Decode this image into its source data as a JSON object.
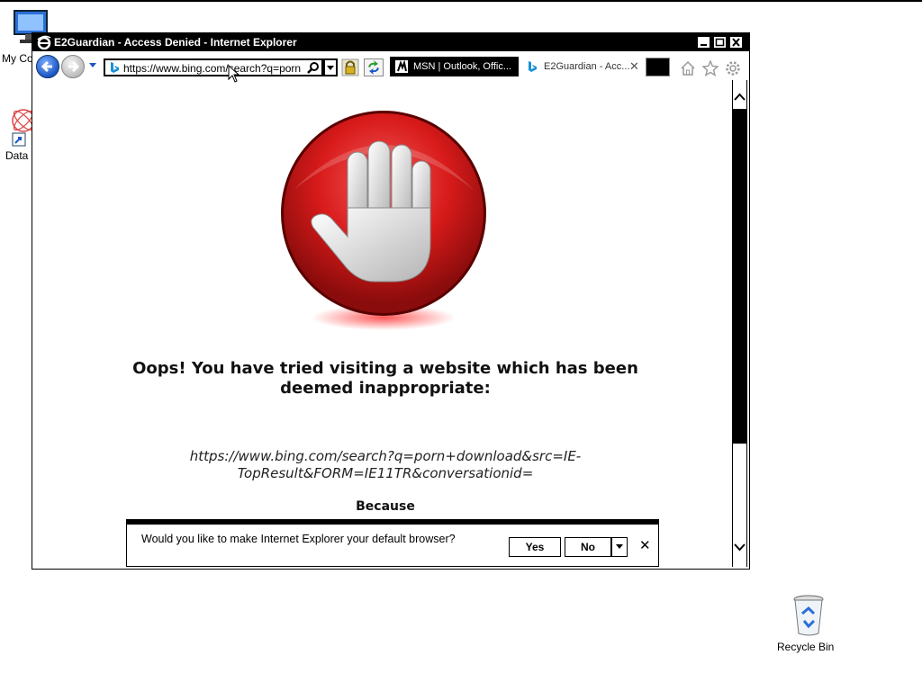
{
  "desktop": {
    "icons": [
      {
        "label": "My Co"
      },
      {
        "label": "Data"
      },
      {
        "label": "Recycle Bin"
      }
    ]
  },
  "window": {
    "title": "E2Guardian - Access Denied - Internet Explorer"
  },
  "navbar": {
    "address_url": "https://www.bing.com/search?q=porn",
    "tabs": [
      {
        "label": "MSN | Outlook, Offic..."
      },
      {
        "label": "E2Guardian - Acc...",
        "close": "✕"
      }
    ]
  },
  "page": {
    "message": "Oops! You have tried visiting a website which has been deemed inappropriate:",
    "blocked_url": "https://www.bing.com/search?q=porn+download&src=IE-TopResult&FORM=IE11TR&conversationid=",
    "because": "Because"
  },
  "notification": {
    "text": "Would you like to make Internet Explorer your default browser?",
    "yes_label": "Yes",
    "no_label": "No",
    "close": "✕"
  },
  "colors": {
    "stop_red": "#d81a1a",
    "back_blue": "#1a56c4"
  }
}
